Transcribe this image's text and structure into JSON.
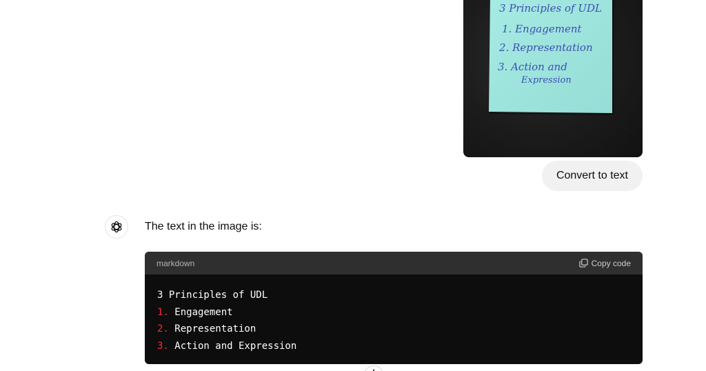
{
  "conversation": {
    "user_message": {
      "image": {
        "description_icon": "photo-of-sticky-note",
        "note_lines": [
          "3 Principles of UDL",
          "1. Engagement",
          "2. Representation",
          "3. Action and",
          "Expression"
        ]
      },
      "text": "Convert to text"
    },
    "assistant_message": {
      "avatar_icon": "openai-logo-icon",
      "intro": "The text in the image is:",
      "code_block": {
        "language": "markdown",
        "copy_label": "Copy code",
        "copy_icon": "copy-icon",
        "lines": [
          {
            "num": "",
            "text": "3 Principles of UDL"
          },
          {
            "num": "1.",
            "text": " Engagement"
          },
          {
            "num": "2.",
            "text": " Representation"
          },
          {
            "num": "3.",
            "text": " Action and Expression"
          }
        ]
      }
    }
  },
  "scroll_button_icon": "arrow-down-icon",
  "colors": {
    "code_bg": "#0d0d0d",
    "code_header_bg": "#2f2f2f",
    "list_number": "#f22c3d",
    "user_bubble_bg": "#f1f1f1",
    "sticky_note": "#9fe6df",
    "handwriting": "#3b4fb0"
  }
}
